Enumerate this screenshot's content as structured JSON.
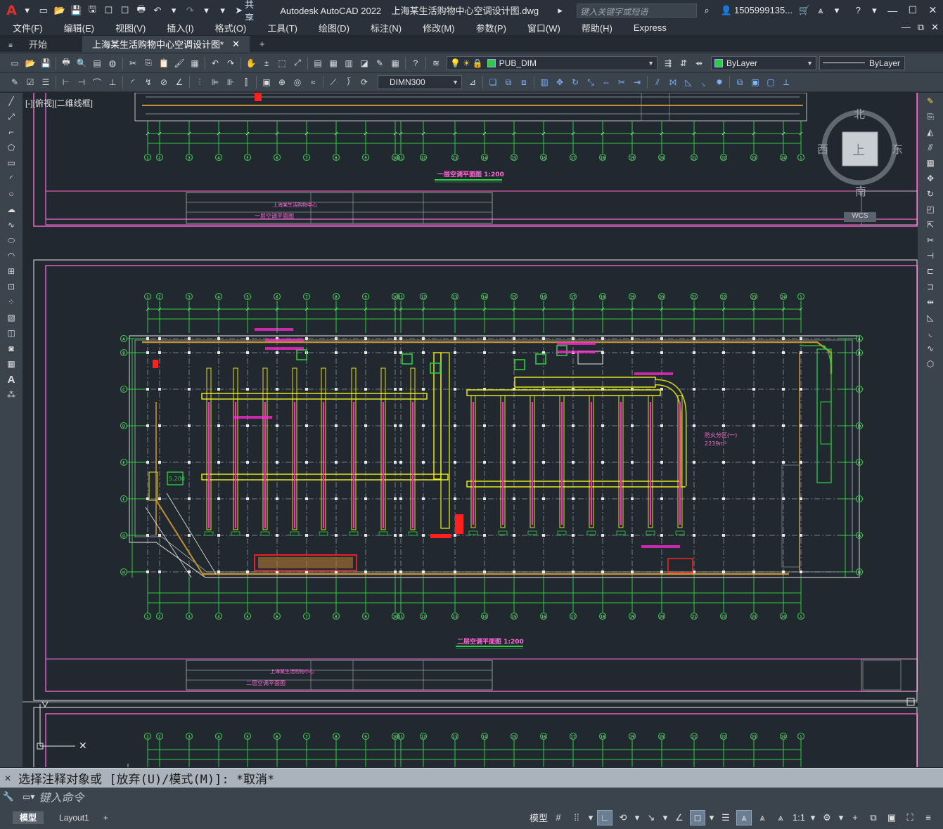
{
  "app": {
    "logo": "A",
    "title": "Autodesk AutoCAD 2022",
    "file": "上海某生活购物中心空调设计图.dwg",
    "share": "共享",
    "search_placeholder": "键入关键字或短语",
    "user": "1505999135..."
  },
  "menu": [
    "文件(F)",
    "编辑(E)",
    "视图(V)",
    "插入(I)",
    "格式(O)",
    "工具(T)",
    "绘图(D)",
    "标注(N)",
    "修改(M)",
    "参数(P)",
    "窗口(W)",
    "帮助(H)",
    "Express"
  ],
  "tabs": {
    "start": "开始",
    "active": "上海某生活购物中心空调设计图*"
  },
  "toolbar": {
    "layer": "PUB_DIM",
    "color": "ByLayer",
    "linetype": "ByLayer",
    "dimstyle": "DIMN300"
  },
  "canvas": {
    "view_label": "[-][俯视][二维线框]",
    "viewcube": {
      "north": "北",
      "south": "南",
      "east": "东",
      "west": "西",
      "top": "上",
      "wcs": "WCS"
    },
    "plan1_title": "一层空调平面图 1:200",
    "plan1_tb_name": "一层空调平面图",
    "plan2_title": "二层空调平面图 1:200",
    "plan2_tb_name": "二层空调平面图",
    "tb_company": "上海某生活购物中心",
    "elev_label": "5.200",
    "room_label": "防火分区(一)",
    "area_label": "2239m²",
    "grid_top": [
      "1",
      "2",
      "3",
      "4",
      "5",
      "6",
      "7",
      "8",
      "9",
      "10",
      "11",
      "12",
      "13",
      "14",
      "15",
      "16",
      "17",
      "18",
      "19",
      "20",
      "21",
      "22",
      "23",
      "24"
    ],
    "grid_side": [
      "A",
      "B",
      "C",
      "D",
      "E",
      "F",
      "G",
      "H"
    ]
  },
  "command": {
    "history": "选择注释对象或 [放弃(U)/模式(M)]: *取消*",
    "placeholder": "键入命令"
  },
  "layouts": [
    "模型",
    "Layout1"
  ],
  "status": {
    "model": "模型",
    "scale": "1:1"
  }
}
